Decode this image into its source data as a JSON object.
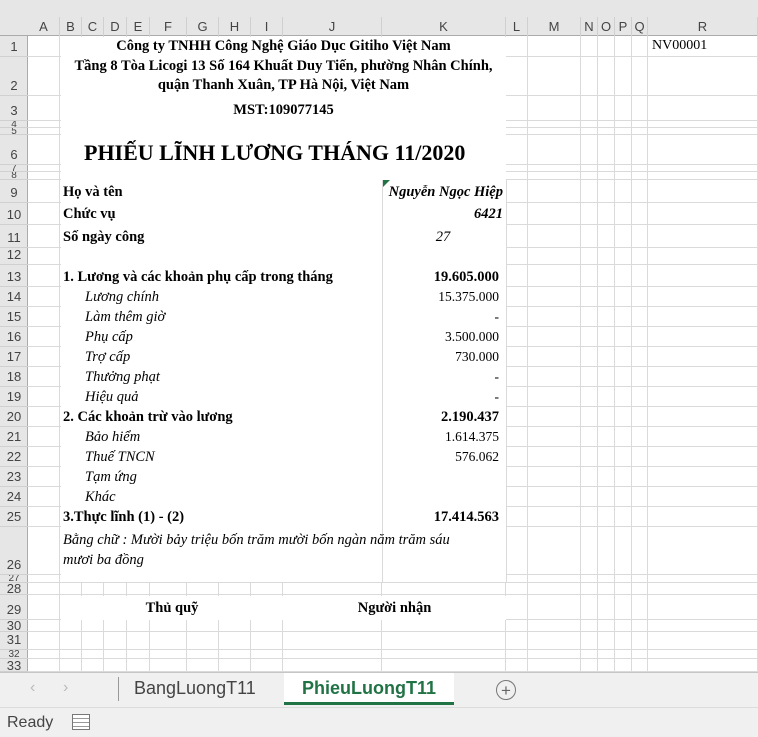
{
  "columns": [
    "A",
    "B",
    "C",
    "D",
    "E",
    "F",
    "G",
    "H",
    "I",
    "J",
    "K",
    "L",
    "M",
    "N",
    "O",
    "P",
    "Q",
    "R"
  ],
  "rows": [
    "1",
    "2",
    "3",
    "5",
    "6",
    "8",
    "9",
    "10",
    "11",
    "12",
    "13",
    "14",
    "15",
    "16",
    "17",
    "18",
    "19",
    "20",
    "21",
    "22",
    "23",
    "24",
    "25",
    "26",
    "27",
    "28",
    "29",
    "30",
    "31",
    "32",
    "33"
  ],
  "header": {
    "company": "Công ty TNHH Công Nghệ Giáo Dục Gitiho Việt Nam",
    "address1": "Tầng 8 Tòa Licogi 13 Số 164 Khuất Duy Tiến, phường Nhân Chính,",
    "address2": "quận Thanh Xuân, TP Hà Nội, Việt Nam",
    "tax": "MST:109077145",
    "employee_id": "NV00001"
  },
  "title": "PHIẾU LĨNH LƯƠNG THÁNG 11/2020",
  "info": [
    {
      "label": "Họ và tên",
      "value": "Nguyễn Ngọc Hiệp"
    },
    {
      "label": "Chức vụ",
      "value": "6421"
    },
    {
      "label": "Số ngày công",
      "value": "27"
    }
  ],
  "lines": [
    {
      "label": "1. Lương và các khoản phụ cấp trong tháng",
      "value": "19.605.000",
      "bold": true
    },
    {
      "label": "Lương chính",
      "value": "15.375.000"
    },
    {
      "label": "Làm thêm giờ",
      "value": "-"
    },
    {
      "label": "Phụ cấp",
      "value": "3.500.000"
    },
    {
      "label": "Trợ cấp",
      "value": "730.000"
    },
    {
      "label": "Thưởng phạt",
      "value": "-"
    },
    {
      "label": "Hiệu quả",
      "value": "-"
    },
    {
      "label": "2. Các khoản trừ vào lương",
      "value": "2.190.437",
      "bold": true
    },
    {
      "label": "Bảo hiểm",
      "value": "1.614.375"
    },
    {
      "label": "Thuế TNCN",
      "value": "576.062"
    },
    {
      "label": "Tạm ứng",
      "value": ""
    },
    {
      "label": "Khác",
      "value": ""
    },
    {
      "label": "3.Thực lĩnh (1) - (2)",
      "value": "17.414.563",
      "bold": true
    }
  ],
  "in_words1": "Bằng chữ : Mười bảy triệu bốn trăm mười bốn ngàn năm trăm sáu",
  "in_words2": "mươi ba đồng",
  "signatures": {
    "treasurer": "Thủ quỹ",
    "receiver": "Người nhận"
  },
  "sheets": [
    "BangLuongT11",
    "PhieuLuongT11"
  ],
  "active_sheet": "PhieuLuongT11",
  "status": "Ready",
  "accent": "#217346"
}
